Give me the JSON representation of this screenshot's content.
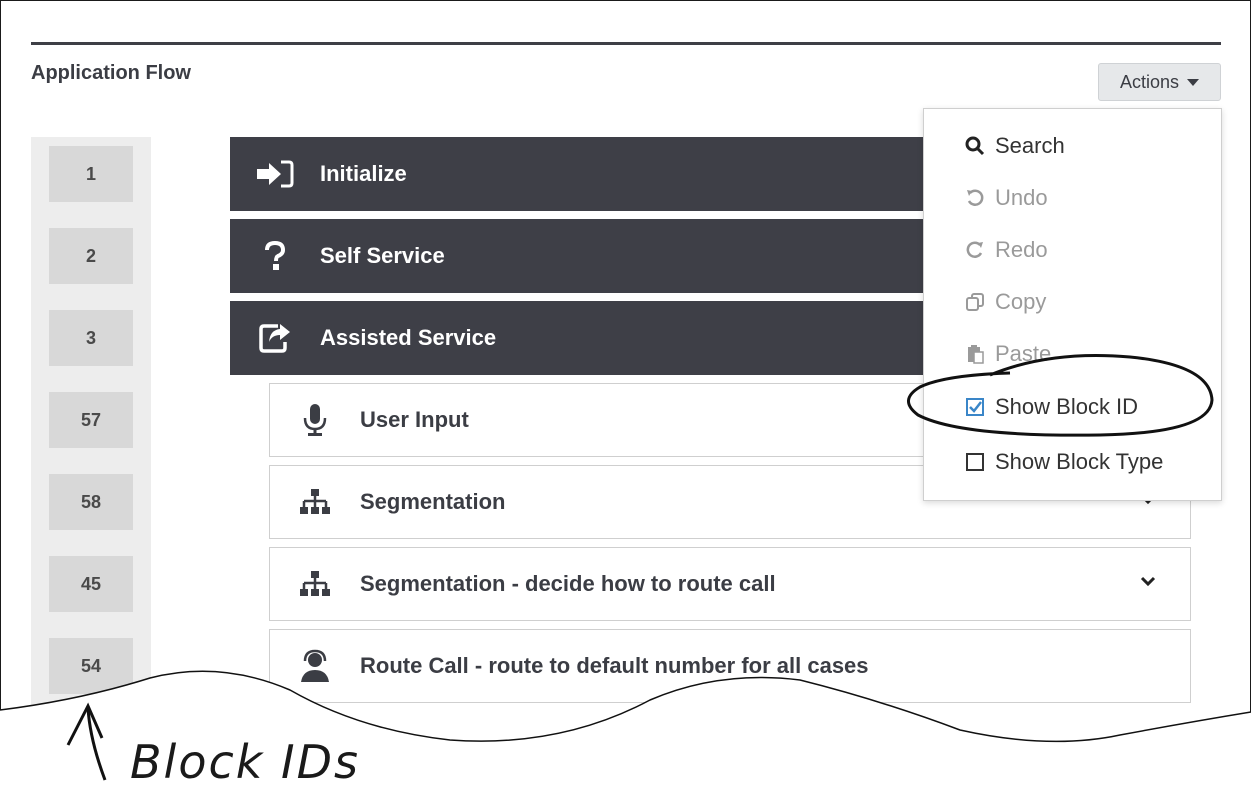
{
  "panel": {
    "title": "Application Flow",
    "actions_label": "Actions"
  },
  "block_ids": [
    "1",
    "2",
    "3",
    "57",
    "58",
    "45",
    "54"
  ],
  "blocks": [
    {
      "label": "Initialize",
      "icon": "sign-in-icon",
      "style": "dark"
    },
    {
      "label": "Self Service",
      "icon": "question-icon",
      "style": "dark"
    },
    {
      "label": "Assisted Service",
      "icon": "share-square-icon",
      "style": "dark"
    },
    {
      "label": "User Input",
      "icon": "microphone-icon",
      "style": "light"
    },
    {
      "label": "Segmentation",
      "icon": "sitemap-icon",
      "style": "light"
    },
    {
      "label": "Segmentation - decide how to route call",
      "icon": "sitemap-icon",
      "style": "light"
    },
    {
      "label": "Route Call - route to default number for all cases",
      "icon": "headset-user-icon",
      "style": "light"
    }
  ],
  "actions_menu": [
    {
      "label": "Search",
      "icon": "search-icon",
      "enabled": true
    },
    {
      "label": "Undo",
      "icon": "undo-icon",
      "enabled": false
    },
    {
      "label": "Redo",
      "icon": "redo-icon",
      "enabled": false
    },
    {
      "label": "Copy",
      "icon": "copy-icon",
      "enabled": false
    },
    {
      "label": "Paste",
      "icon": "paste-icon",
      "enabled": false
    },
    {
      "label": "Show Block ID",
      "icon": "checkbox-checked-icon",
      "checked": true
    },
    {
      "label": "Show Block Type",
      "icon": "checkbox-unchecked-icon",
      "checked": false
    }
  ],
  "annotation": {
    "text": "Block IDs"
  },
  "colors": {
    "dark_block": "#3e3f47",
    "accent_check": "#3a86c8",
    "id_column": "#ededed"
  }
}
